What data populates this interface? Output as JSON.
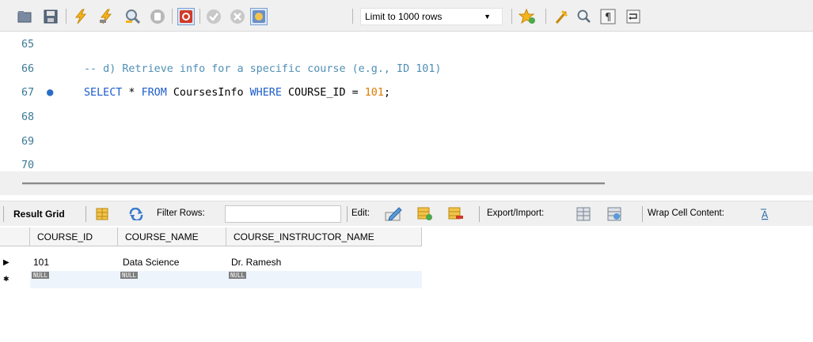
{
  "toolbar": {
    "icons": [
      "open-folder-icon",
      "save-icon",
      "execute-icon",
      "execute-current-icon",
      "explain-icon",
      "stop-icon",
      "toggle-error-stop-icon",
      "commit-icon",
      "rollback-icon",
      "autocommit-icon",
      "beautify-star-icon",
      "clean-brush-icon",
      "find-icon",
      "invisible-chars-icon",
      "wrap-icon"
    ],
    "limit_label": "Limit to 1000 rows"
  },
  "editor": {
    "lines": [
      {
        "number": "65",
        "code": ""
      },
      {
        "number": "66",
        "comment": "-- d) Retrieve info for a specific course (e.g., ID 101)"
      },
      {
        "number": "67",
        "marker": "●",
        "kw1": "SELECT",
        "t1": " * ",
        "kw2": "FROM",
        "t2": " CoursesInfo ",
        "kw3": "WHERE",
        "t3": " COURSE_ID = ",
        "num": "101",
        "t4": ";"
      },
      {
        "number": "68",
        "code": ""
      },
      {
        "number": "69",
        "code": ""
      },
      {
        "number": "70",
        "code": ""
      }
    ]
  },
  "result_toolbar": {
    "result_grid": "Result Grid",
    "filter_rows": "Filter Rows:",
    "edit": "Edit:",
    "export_import": "Export/Import:",
    "wrap_cell": "Wrap Cell Content:"
  },
  "grid": {
    "columns": [
      "COURSE_ID",
      "COURSE_NAME",
      "COURSE_INSTRUCTOR_NAME"
    ],
    "rows": [
      [
        "101",
        "Data Science",
        "Dr. Ramesh"
      ]
    ],
    "row_marker": "▶",
    "new_row_marker": "✱",
    "null_label": "NULL"
  },
  "colors": {
    "keyword": "#1c5cc9",
    "comment": "#4f8fb4",
    "number": "#e07b00",
    "line_number": "#3c7a96"
  }
}
